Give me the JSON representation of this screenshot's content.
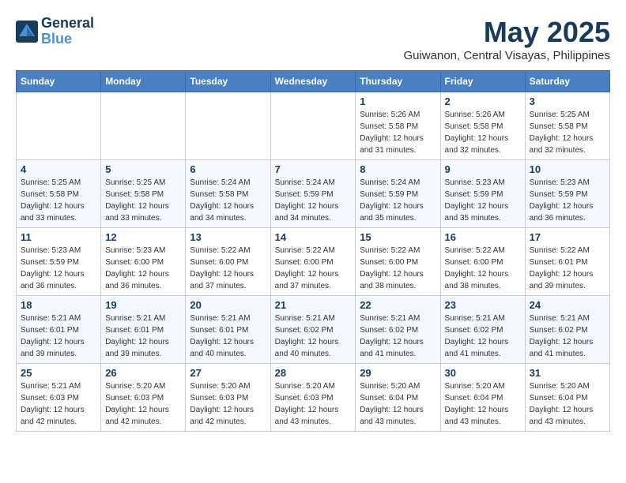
{
  "header": {
    "logo_line1": "General",
    "logo_line2": "Blue",
    "month": "May 2025",
    "location": "Guiwanon, Central Visayas, Philippines"
  },
  "weekdays": [
    "Sunday",
    "Monday",
    "Tuesday",
    "Wednesday",
    "Thursday",
    "Friday",
    "Saturday"
  ],
  "weeks": [
    [
      {
        "day": "",
        "sunrise": "",
        "sunset": "",
        "daylight": ""
      },
      {
        "day": "",
        "sunrise": "",
        "sunset": "",
        "daylight": ""
      },
      {
        "day": "",
        "sunrise": "",
        "sunset": "",
        "daylight": ""
      },
      {
        "day": "",
        "sunrise": "",
        "sunset": "",
        "daylight": ""
      },
      {
        "day": "1",
        "sunrise": "5:26 AM",
        "sunset": "5:58 PM",
        "daylight": "12 hours and 31 minutes."
      },
      {
        "day": "2",
        "sunrise": "5:26 AM",
        "sunset": "5:58 PM",
        "daylight": "12 hours and 32 minutes."
      },
      {
        "day": "3",
        "sunrise": "5:25 AM",
        "sunset": "5:58 PM",
        "daylight": "12 hours and 32 minutes."
      }
    ],
    [
      {
        "day": "4",
        "sunrise": "5:25 AM",
        "sunset": "5:58 PM",
        "daylight": "12 hours and 33 minutes."
      },
      {
        "day": "5",
        "sunrise": "5:25 AM",
        "sunset": "5:58 PM",
        "daylight": "12 hours and 33 minutes."
      },
      {
        "day": "6",
        "sunrise": "5:24 AM",
        "sunset": "5:58 PM",
        "daylight": "12 hours and 34 minutes."
      },
      {
        "day": "7",
        "sunrise": "5:24 AM",
        "sunset": "5:59 PM",
        "daylight": "12 hours and 34 minutes."
      },
      {
        "day": "8",
        "sunrise": "5:24 AM",
        "sunset": "5:59 PM",
        "daylight": "12 hours and 35 minutes."
      },
      {
        "day": "9",
        "sunrise": "5:23 AM",
        "sunset": "5:59 PM",
        "daylight": "12 hours and 35 minutes."
      },
      {
        "day": "10",
        "sunrise": "5:23 AM",
        "sunset": "5:59 PM",
        "daylight": "12 hours and 36 minutes."
      }
    ],
    [
      {
        "day": "11",
        "sunrise": "5:23 AM",
        "sunset": "5:59 PM",
        "daylight": "12 hours and 36 minutes."
      },
      {
        "day": "12",
        "sunrise": "5:23 AM",
        "sunset": "6:00 PM",
        "daylight": "12 hours and 36 minutes."
      },
      {
        "day": "13",
        "sunrise": "5:22 AM",
        "sunset": "6:00 PM",
        "daylight": "12 hours and 37 minutes."
      },
      {
        "day": "14",
        "sunrise": "5:22 AM",
        "sunset": "6:00 PM",
        "daylight": "12 hours and 37 minutes."
      },
      {
        "day": "15",
        "sunrise": "5:22 AM",
        "sunset": "6:00 PM",
        "daylight": "12 hours and 38 minutes."
      },
      {
        "day": "16",
        "sunrise": "5:22 AM",
        "sunset": "6:00 PM",
        "daylight": "12 hours and 38 minutes."
      },
      {
        "day": "17",
        "sunrise": "5:22 AM",
        "sunset": "6:01 PM",
        "daylight": "12 hours and 39 minutes."
      }
    ],
    [
      {
        "day": "18",
        "sunrise": "5:21 AM",
        "sunset": "6:01 PM",
        "daylight": "12 hours and 39 minutes."
      },
      {
        "day": "19",
        "sunrise": "5:21 AM",
        "sunset": "6:01 PM",
        "daylight": "12 hours and 39 minutes."
      },
      {
        "day": "20",
        "sunrise": "5:21 AM",
        "sunset": "6:01 PM",
        "daylight": "12 hours and 40 minutes."
      },
      {
        "day": "21",
        "sunrise": "5:21 AM",
        "sunset": "6:02 PM",
        "daylight": "12 hours and 40 minutes."
      },
      {
        "day": "22",
        "sunrise": "5:21 AM",
        "sunset": "6:02 PM",
        "daylight": "12 hours and 41 minutes."
      },
      {
        "day": "23",
        "sunrise": "5:21 AM",
        "sunset": "6:02 PM",
        "daylight": "12 hours and 41 minutes."
      },
      {
        "day": "24",
        "sunrise": "5:21 AM",
        "sunset": "6:02 PM",
        "daylight": "12 hours and 41 minutes."
      }
    ],
    [
      {
        "day": "25",
        "sunrise": "5:21 AM",
        "sunset": "6:03 PM",
        "daylight": "12 hours and 42 minutes."
      },
      {
        "day": "26",
        "sunrise": "5:20 AM",
        "sunset": "6:03 PM",
        "daylight": "12 hours and 42 minutes."
      },
      {
        "day": "27",
        "sunrise": "5:20 AM",
        "sunset": "6:03 PM",
        "daylight": "12 hours and 42 minutes."
      },
      {
        "day": "28",
        "sunrise": "5:20 AM",
        "sunset": "6:03 PM",
        "daylight": "12 hours and 43 minutes."
      },
      {
        "day": "29",
        "sunrise": "5:20 AM",
        "sunset": "6:04 PM",
        "daylight": "12 hours and 43 minutes."
      },
      {
        "day": "30",
        "sunrise": "5:20 AM",
        "sunset": "6:04 PM",
        "daylight": "12 hours and 43 minutes."
      },
      {
        "day": "31",
        "sunrise": "5:20 AM",
        "sunset": "6:04 PM",
        "daylight": "12 hours and 43 minutes."
      }
    ]
  ],
  "labels": {
    "sunrise": "Sunrise:",
    "sunset": "Sunset:",
    "daylight": "Daylight:"
  }
}
